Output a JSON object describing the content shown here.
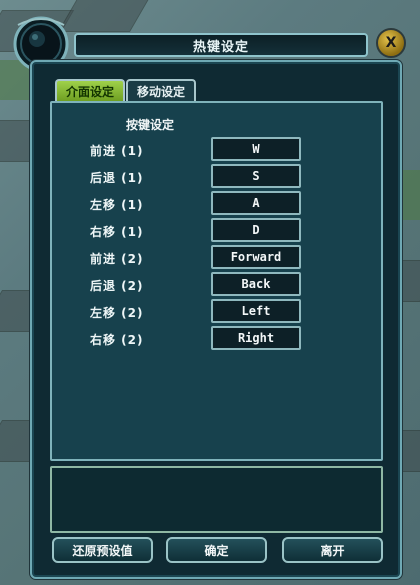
{
  "window": {
    "title": "热键设定",
    "close_label": "X"
  },
  "tabs": [
    {
      "label": "介面设定",
      "active": true
    },
    {
      "label": "移动设定",
      "active": false
    }
  ],
  "panel": {
    "section_title": "按键设定",
    "rows": [
      {
        "label": "前进 (1)",
        "key": "W"
      },
      {
        "label": "后退 (1)",
        "key": "S"
      },
      {
        "label": "左移 (1)",
        "key": "A"
      },
      {
        "label": "右移 (1)",
        "key": "D"
      },
      {
        "label": "前进 (2)",
        "key": "Forward"
      },
      {
        "label": "后退 (2)",
        "key": "Back"
      },
      {
        "label": "左移 (2)",
        "key": "Left"
      },
      {
        "label": "右移 (2)",
        "key": "Right"
      }
    ]
  },
  "buttons": {
    "restore": "还原预设值",
    "confirm": "确定",
    "leave": "离开"
  },
  "colors": {
    "active_tab": "#8ac43a",
    "panel": "#17414d",
    "border": "#7fb3bb"
  }
}
